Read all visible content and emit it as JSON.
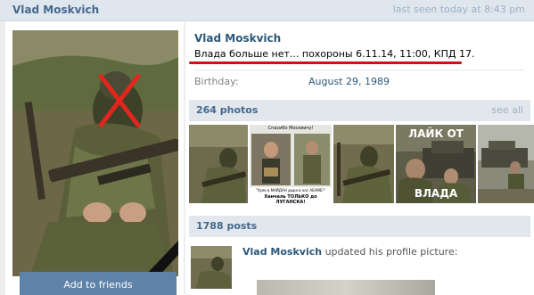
{
  "header": {
    "name": "Vlad Moskvich",
    "last_seen": "last seen today at 8:43 pm"
  },
  "profile": {
    "name": "Vlad Moskvich",
    "status": "Влада больше нет... похороны 6.11.14, 11:00, КПД 17.",
    "birthday_label": "Birthday:",
    "birthday_value": "August 29, 1989"
  },
  "actions": {
    "add_friend_label": "Add to friends"
  },
  "photos": {
    "header": "264 photos",
    "see_all": "see all",
    "captions": {
      "photo2_top": "Спасибо Москвичу!",
      "photo2_bottom_1": "\"Хуяк в МАЙДАН дыра в нос АБАМЕ!\"",
      "photo2_bottom_2": "Ханчаль ТОЛЬКО до ЛУГАНСКА!",
      "photo4_top": "ЛАЙК ОТ",
      "photo4_bottom": "ВЛАДА"
    }
  },
  "posts": {
    "header": "1788 posts",
    "author": "Vlad Moskvich",
    "action": " updated his profile picture:"
  },
  "colors": {
    "link": "#2b587a",
    "button": "#5e82a8",
    "underline": "#d10f14"
  }
}
